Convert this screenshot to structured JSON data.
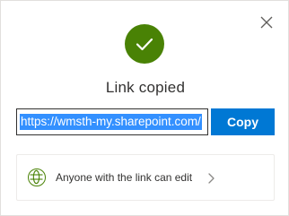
{
  "dialog": {
    "title": "Link copied",
    "link_value": "https://wmsth-my.sharepoint.com/",
    "copy_label": "Copy",
    "permission_label": "Anyone with the link can edit"
  },
  "icons": {
    "close": "close-icon",
    "success": "checkmark-icon",
    "permission": "globe-icon",
    "chevron": "chevron-right-icon"
  },
  "colors": {
    "success_green": "#498205",
    "primary_blue": "#0078d4",
    "selection_blue": "#3390ff",
    "text": "#323130"
  }
}
